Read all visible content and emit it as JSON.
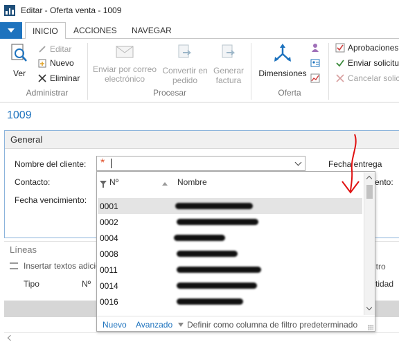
{
  "window": {
    "title": "Editar - Oferta venta - 1009"
  },
  "ribbon": {
    "tabs": [
      "INICIO",
      "ACCIONES",
      "NAVEGAR"
    ],
    "administrar": {
      "ver": "Ver",
      "editar": "Editar",
      "nuevo": "Nuevo",
      "eliminar": "Eliminar",
      "label": "Administrar"
    },
    "procesar": {
      "enviar_correo": [
        "Enviar por correo",
        "electrónico"
      ],
      "convertir": [
        "Convertir en",
        "pedido"
      ],
      "generar": [
        "Generar",
        "factura"
      ],
      "label": "Procesar"
    },
    "oferta": {
      "dimensiones": "Dimensiones",
      "label": "Oferta"
    },
    "aprobaciones": {
      "aprobaciones": "Aprobaciones",
      "enviar_solicitud": "Enviar solicitu",
      "cancelar_solicitud": "Cancelar solici"
    }
  },
  "record": {
    "number": "1009"
  },
  "general": {
    "title": "General",
    "nombre_cliente_label": "Nombre del cliente:",
    "contacto_label": "Contacto:",
    "fecha_vencimiento_label": "Fecha vencimiento:",
    "fecha_entrega_label": "Fecha entrega requ",
    "ento_label": "ento:",
    "nombre_cliente_value": ""
  },
  "lines": {
    "title": "Líneas",
    "insertar": "Insertar textos adicio",
    "filtro": "ltro",
    "col_tipo": "Tipo",
    "col_no": "Nº",
    "col_cantidad": "tidad"
  },
  "dropdown": {
    "col_no": "Nº",
    "col_nombre": "Nombre",
    "rows": [
      "0001",
      "0002",
      "0004",
      "0008",
      "0011",
      "0014",
      "0016"
    ],
    "footer": {
      "nuevo": "Nuevo",
      "avanzado": "Avanzado",
      "definir": "Definir como columna de filtro predeterminado"
    }
  },
  "colors": {
    "accent": "#1e73be",
    "required": "#e0502a",
    "annotation": "#e01010"
  }
}
